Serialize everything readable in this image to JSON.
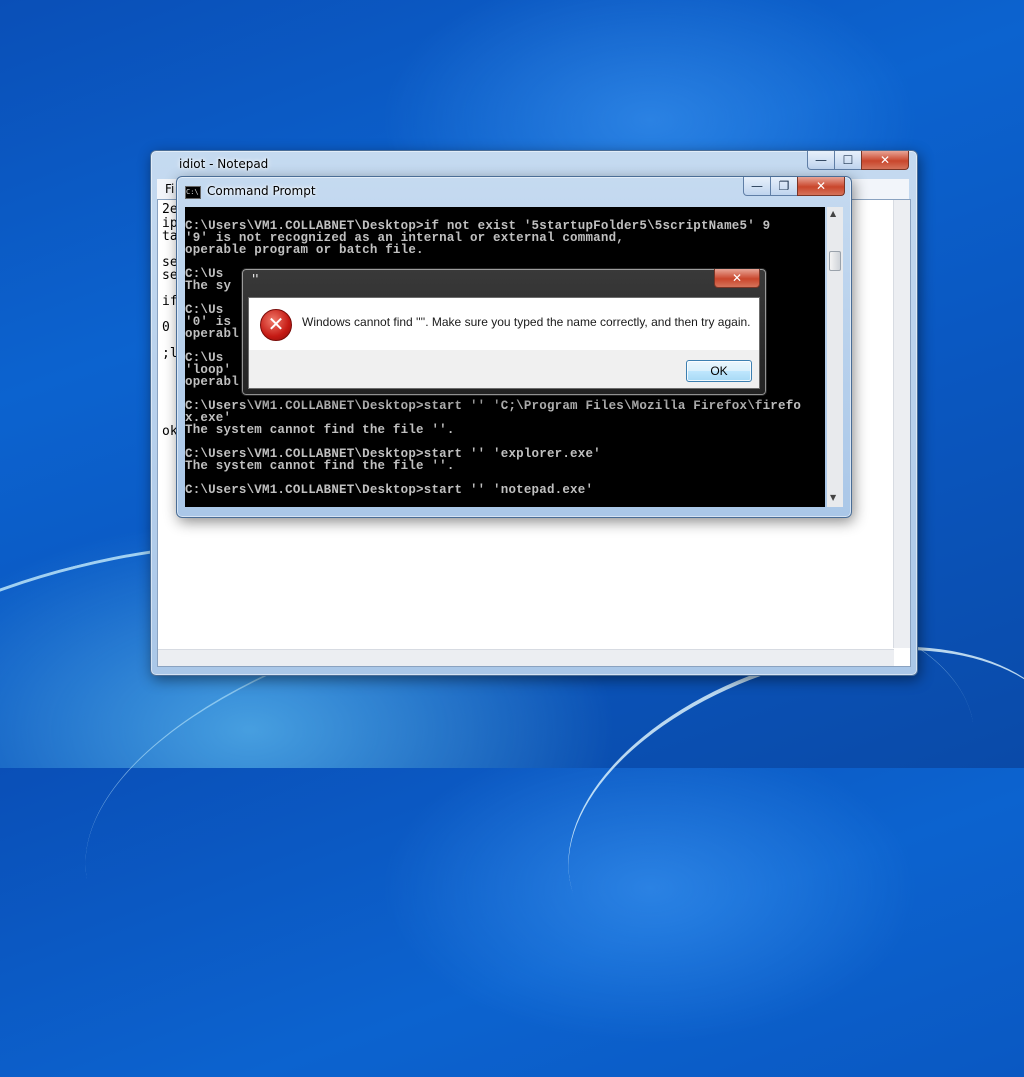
{
  "notepad": {
    "title": "idiot - Notepad",
    "menu_partial": "Fi",
    "text_fragments": [
      "2e",
      "ip",
      "ta",
      "se",
      "se",
      "if",
      "0",
      ";l",
      "ok"
    ],
    "buttons": {
      "minimize": "—",
      "maximize": "☐",
      "close": "✕"
    }
  },
  "cmd": {
    "title": "Command Prompt",
    "buttons": {
      "minimize": "—",
      "restore": "❐",
      "close": "✕"
    },
    "lines": [
      "C:\\Users\\VM1.COLLABNET\\Desktop>if not exist '5startupFolder5\\5scriptName5' 9",
      "'9' is not recognized as an internal or external command,",
      "operable program or batch file.",
      "",
      "C:\\Us",
      "The sy",
      "",
      "C:\\Us",
      "'0' is",
      "operabl",
      "",
      "C:\\Us",
      "'loop'",
      "operabl",
      "",
      "C:\\Users\\VM1.COLLABNET\\Desktop>start '' 'C;\\Program Files\\Mozilla Firefox\\firefo",
      "x.exe'",
      "The system cannot find the file ''.",
      "",
      "C:\\Users\\VM1.COLLABNET\\Desktop>start '' 'explorer.exe'",
      "The system cannot find the file ''.",
      "",
      "C:\\Users\\VM1.COLLABNET\\Desktop>start '' 'notepad.exe'"
    ]
  },
  "dialog": {
    "title": "''",
    "message": "Windows cannot find ''''. Make sure you typed the name correctly, and then try again.",
    "ok_label": "OK",
    "close": "✕",
    "icon": "error-icon"
  }
}
